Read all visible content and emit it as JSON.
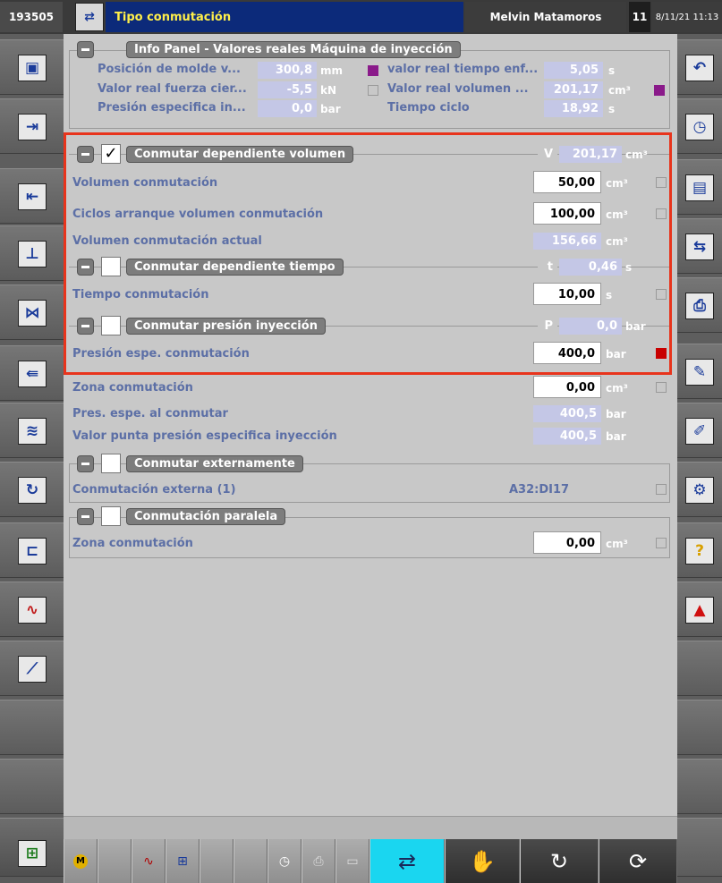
{
  "top_bar": {
    "machine_id": "193505",
    "title": "Tipo conmutación",
    "user": "Melvin Matamoros",
    "user_level": "11",
    "datetime": "8/11/21 11:13"
  },
  "info_panel": {
    "title": "Info Panel - Valores reales Máquina de inyección",
    "rows": [
      {
        "label": "Posición de molde v...",
        "value": "300,8",
        "unit": "mm",
        "label2": "valor real tiempo enf...",
        "value2": "5,05",
        "unit2": "s"
      },
      {
        "label": "Valor real fuerza cier...",
        "value": "-5,5",
        "unit": "kN",
        "label2": "Valor real volumen ...",
        "value2": "201,17",
        "unit2": "cm³"
      },
      {
        "label": "Presión especifica in...",
        "value": "0,0",
        "unit": "bar",
        "label2": "Tiempo ciclo",
        "value2": "18,92",
        "unit2": "s"
      }
    ]
  },
  "vol_section": {
    "title": "Conmutar dependiente volumen",
    "checked_mark": "✓",
    "actual_prefix": "V",
    "actual_value": "201,17",
    "actual_unit": "cm³",
    "rows": [
      {
        "label": "Volumen conmutación",
        "value": "50,00",
        "unit": "cm³"
      },
      {
        "label": "Ciclos arranque volumen conmutación",
        "value": "100,00",
        "unit": "cm³"
      },
      {
        "label": "Volumen conmutación actual",
        "value": "156,66",
        "unit": "cm³"
      }
    ]
  },
  "time_section": {
    "title": "Conmutar dependiente tiempo",
    "actual_prefix": "t",
    "actual_value": "0,46",
    "actual_unit": "s",
    "rows": [
      {
        "label": "Tiempo conmutación",
        "value": "10,00",
        "unit": "s"
      }
    ]
  },
  "pressure_section": {
    "title": "Conmutar presión inyección",
    "actual_prefix": "P",
    "actual_value": "0,0",
    "actual_unit": "bar",
    "rows": [
      {
        "label": "Presión espe. conmutación",
        "value": "400,0",
        "unit": "bar"
      }
    ]
  },
  "after_rows": [
    {
      "label": "Zona conmutación",
      "value": "0,00",
      "unit": "cm³"
    },
    {
      "label": "Pres. espe. al conmutar",
      "value": "400,5",
      "unit": "bar"
    },
    {
      "label": "Valor punta presión especifica inyección",
      "value": "400,5",
      "unit": "bar"
    }
  ],
  "external_section": {
    "title": "Conmutar externamente",
    "rows": [
      {
        "label": "Conmutación externa (1)",
        "value": "A32:DI17"
      }
    ]
  },
  "parallel_section": {
    "title": "Conmutación paralela",
    "rows": [
      {
        "label": "Zona conmutación",
        "value": "0,00",
        "unit": "cm³"
      }
    ]
  },
  "colors": {
    "highlight_border": "#e8341c",
    "label_blue": "#5c6fa6",
    "value_bg": "#c4c7e6",
    "marker_purple": "#8a1a8a",
    "marker_red": "#c80000",
    "cyan_button": "#1ad6f0"
  },
  "bottom_bar": {
    "motor_label": "M"
  },
  "icons": {
    "left": [
      "mold-setup-icon",
      "mold-close-icon",
      "mold-open-icon",
      "ejector-icon",
      "core-pull-icon",
      "injection-icon",
      "holding-pressure-icon",
      "plasticizing-icon",
      "nozzle-icon",
      "temperature-icon",
      "graph-icon"
    ],
    "right": [
      "back-icon",
      "cycle-time-icon",
      "page-icon",
      "page-switch-icon",
      "printer-icon",
      "edit-icon",
      "edit-list-icon",
      "settings-list-icon",
      "help-icon",
      "alarm-icon"
    ]
  }
}
